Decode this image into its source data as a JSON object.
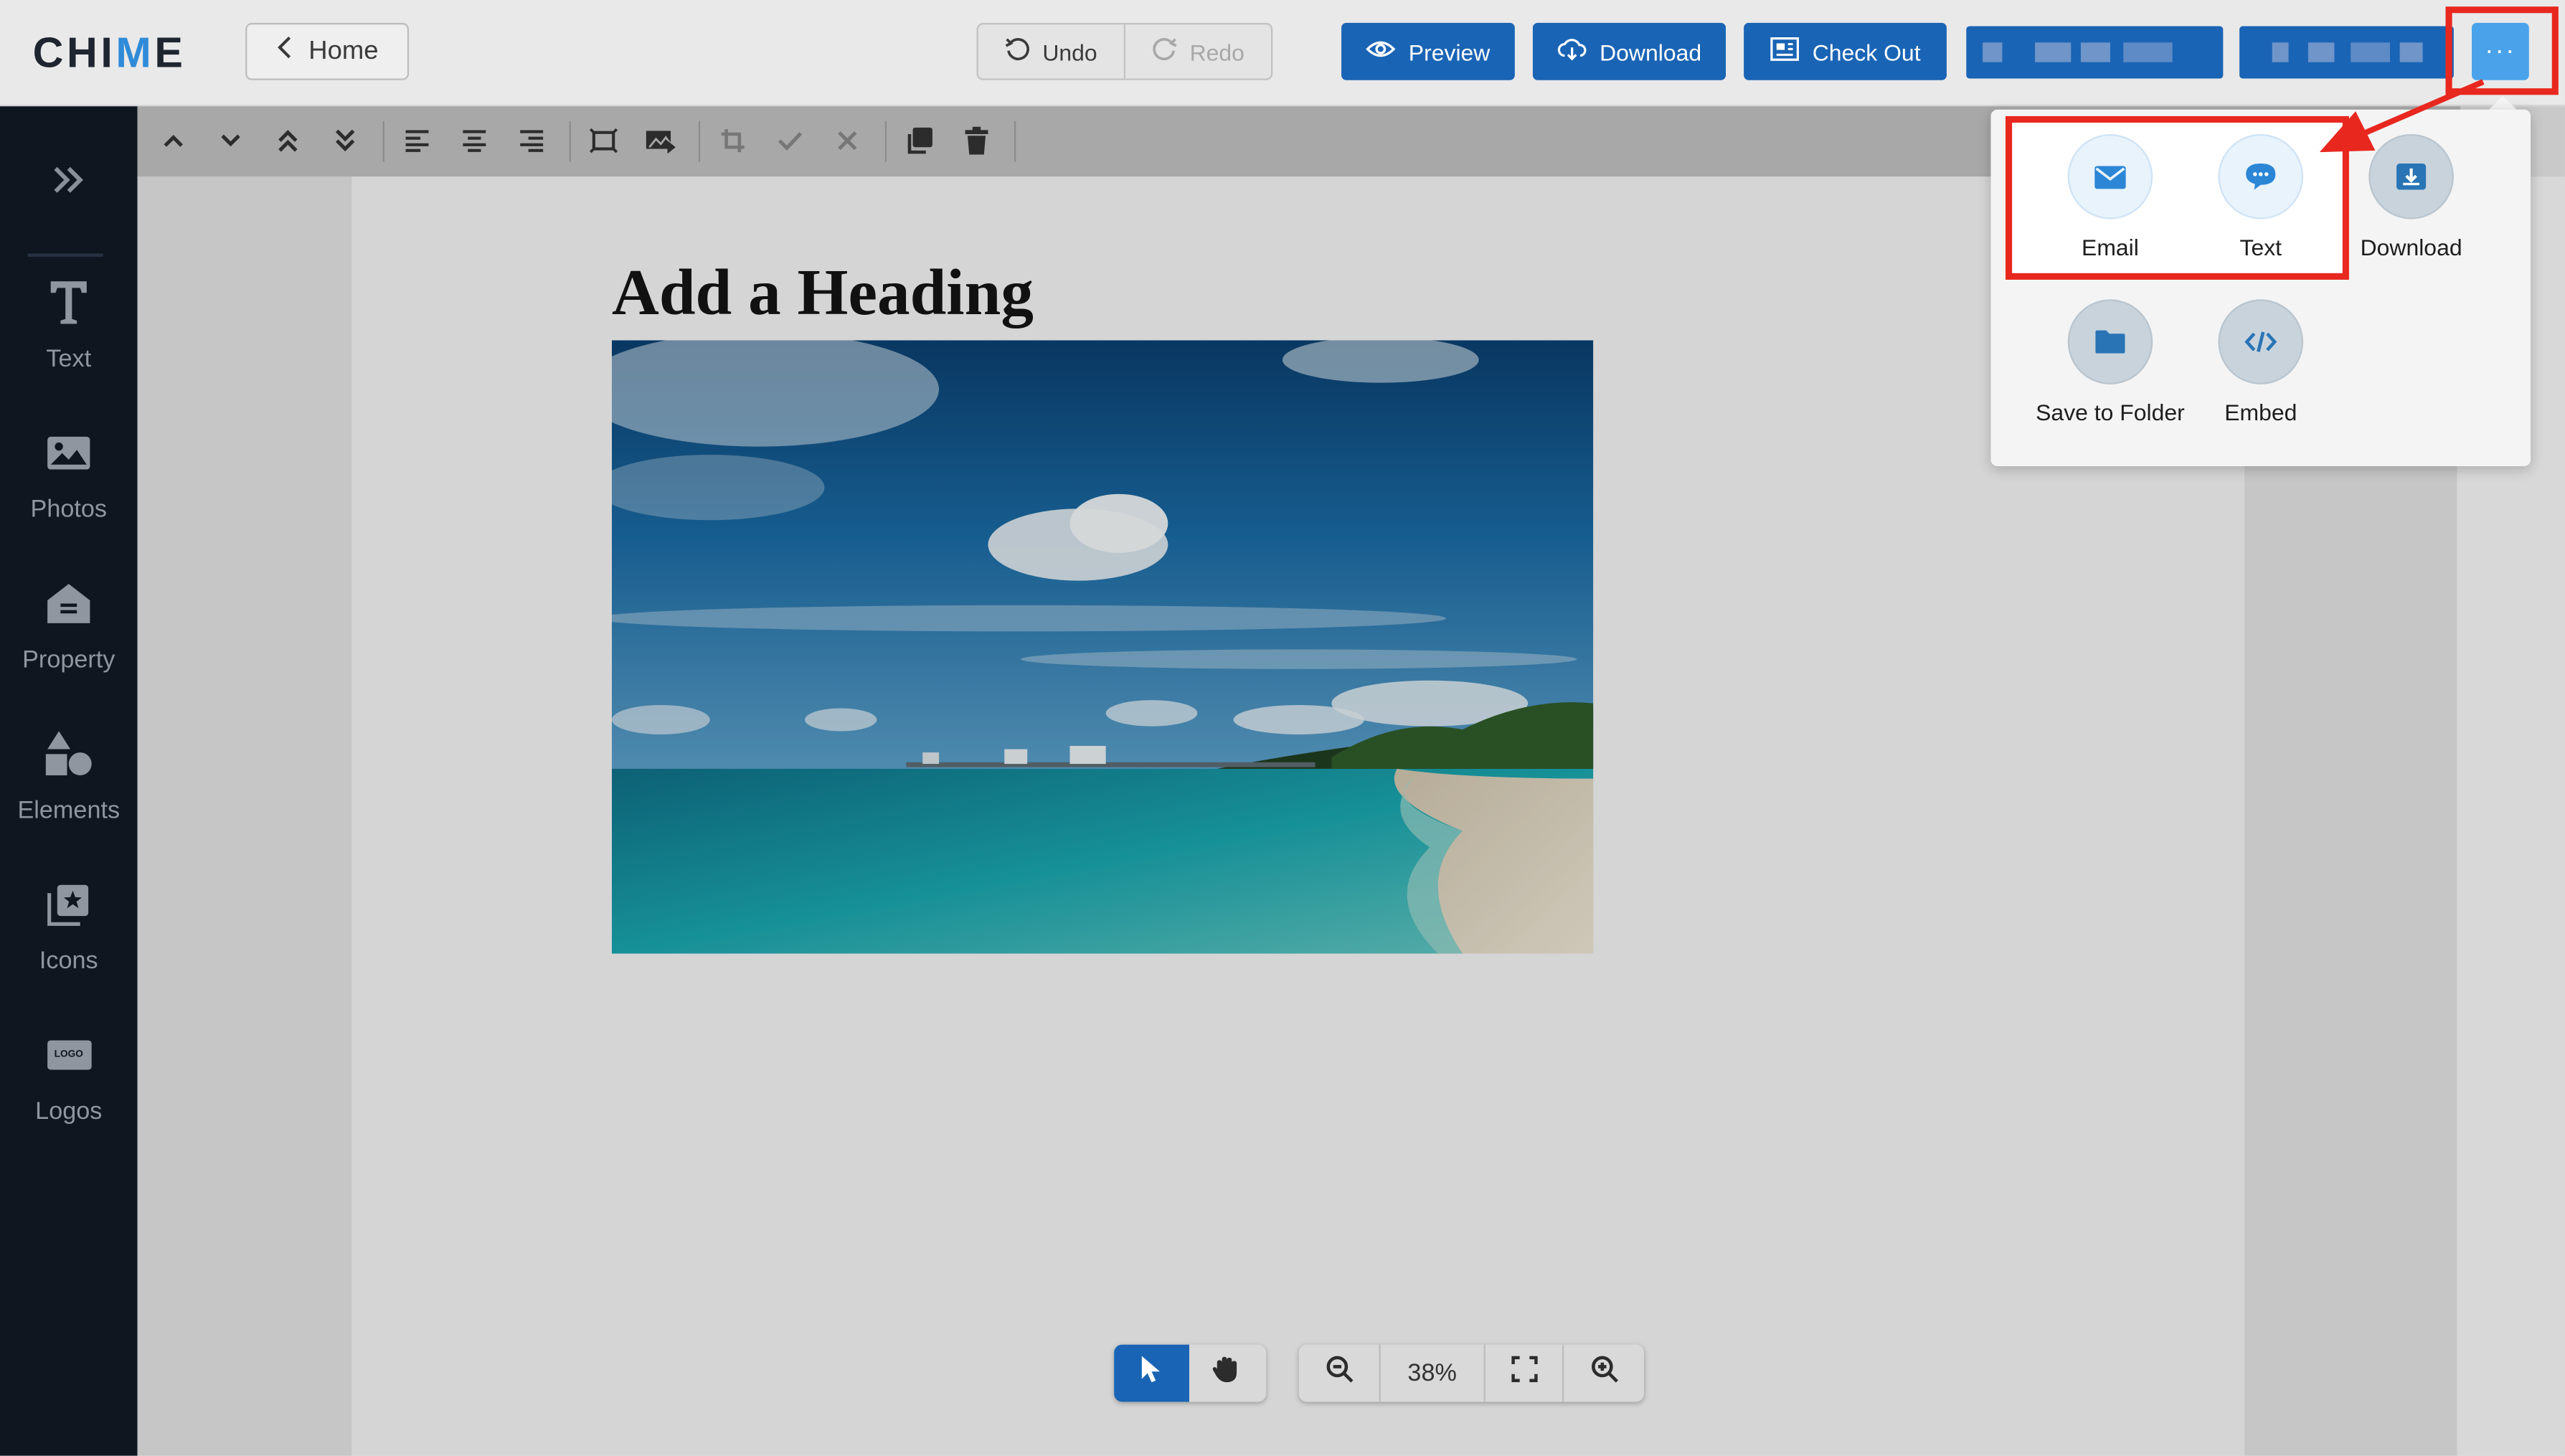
{
  "app": {
    "logo": {
      "text_before": "CHI",
      "text_accent": "M",
      "text_after": "E"
    },
    "home_label": "Home"
  },
  "header": {
    "undo_label": "Undo",
    "redo_label": "Redo",
    "preview_label": "Preview",
    "download_label": "Download",
    "checkout_label": "Check Out",
    "more_label": "···"
  },
  "sidebar": {
    "items": [
      {
        "label": "Text",
        "icon": "text-icon"
      },
      {
        "label": "Photos",
        "icon": "photo-icon"
      },
      {
        "label": "Property",
        "icon": "property-icon"
      },
      {
        "label": "Elements",
        "icon": "shapes-icon"
      },
      {
        "label": "Icons",
        "icon": "icon-star-icon"
      },
      {
        "label": "Logos",
        "icon": "logo-icon"
      }
    ],
    "logo_icon_text": "LOGO"
  },
  "canvas": {
    "heading": "Add a Heading",
    "zoom": "38%"
  },
  "share_menu": {
    "items": [
      {
        "label": "Email",
        "icon": "email-icon"
      },
      {
        "label": "Text",
        "icon": "chat-bubble-icon"
      },
      {
        "label": "Download",
        "icon": "download-icon"
      },
      {
        "label": "Save to Folder",
        "icon": "folder-icon"
      },
      {
        "label": "Embed",
        "icon": "code-icon"
      }
    ]
  },
  "colors": {
    "primary": "#1a64b5",
    "accent_light": "#4aa3ea",
    "sidebar_bg": "#0f1620",
    "highlight": "#e8281f"
  }
}
